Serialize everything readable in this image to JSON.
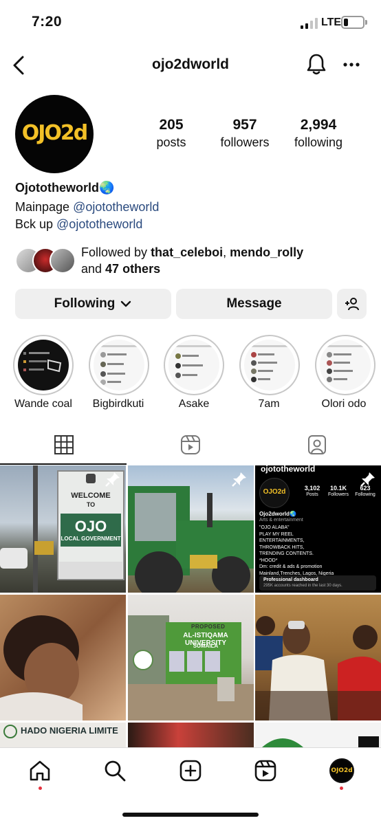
{
  "status_bar": {
    "time": "7:20",
    "network": "LTE"
  },
  "header": {
    "username": "ojo2dworld"
  },
  "profile": {
    "avatar_text": "OJO2d",
    "posts_count": "205",
    "posts_label": "posts",
    "followers_count": "957",
    "followers_label": "followers",
    "following_count": "2,994",
    "following_label": "following",
    "display_name": "Ojototheworld🌏",
    "bio_line1_prefix": "Mainpage ",
    "bio_line1_mention": "@ojototheworld",
    "bio_line2_prefix": "Bck up ",
    "bio_line2_mention": "@ojototheworld"
  },
  "mutuals": {
    "prefix": "Followed by ",
    "names": "that_celeboi",
    "sep": ", ",
    "names2": "mendo_rolly",
    "line2_prefix": "and ",
    "others": "47 others"
  },
  "buttons": {
    "following": "Following",
    "message": "Message"
  },
  "highlights": [
    {
      "label": "Wande coal"
    },
    {
      "label": "Bigbirdkuti"
    },
    {
      "label": "Asake"
    },
    {
      "label": "7am"
    },
    {
      "label": "Olori odo"
    }
  ],
  "posts": {
    "post1": {
      "sign_line1": "WELCOME",
      "sign_line2": "TO",
      "sign_line3": "OJO",
      "sign_line4": "LOCAL GOVERNMENT"
    },
    "post3": {
      "username": "ojototheworld",
      "logo": "OJO2d",
      "posts_num": "3,102",
      "posts_lbl": "Posts",
      "followers_num": "10.1K",
      "followers_lbl": "Followers",
      "following_num": "623",
      "following_lbl": "Following",
      "name": "Ojo2dworld🌏",
      "category": "Arts & entertainment",
      "bio": [
        "\"OJO ALABA\"",
        "PLAY MY REEL",
        "ENTERTAINMENTS,",
        "THROWBACK HITS,",
        "TRENDING CONTENTS.",
        "*HOOD*",
        "Dm: credit & ads & promotion",
        "Mainland,Trenches, Lagos, Nigeria"
      ],
      "dash_title": "Professional dashboard",
      "dash_sub": "295K accounts reached in the last 30 days."
    },
    "post5": {
      "sign_top": "PROPOSED",
      "sign_main": "AL-ISTIQAMA UNIVERSITY",
      "sign_sub": "SUMAILA"
    },
    "post7": {
      "banner": "HADO NIGERIA LIMITE"
    }
  },
  "colors": {
    "mention": "#2a4a7e",
    "notification_dot": "#e5323f",
    "button_bg": "#efefef"
  }
}
